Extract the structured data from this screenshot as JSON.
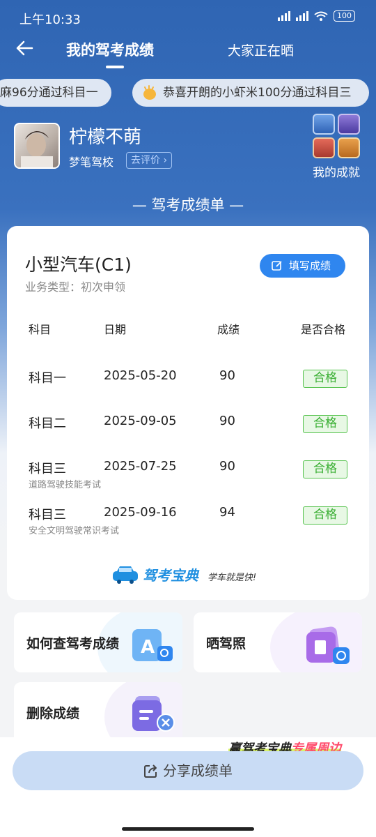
{
  "status_bar": {
    "time": "上午10:33",
    "battery": "100"
  },
  "header": {
    "title": "我的驾考成绩",
    "tab_other": "大家正在晒"
  },
  "ticker": [
    {
      "text": "麻96分通过科目一"
    },
    {
      "text": "恭喜开朗的小虾米100分通过科目三"
    }
  ],
  "profile": {
    "name": "柠檬不萌",
    "school": "梦笔驾校",
    "rate_label": "去评价",
    "achievements_label": "我的成就"
  },
  "section_title": "— 驾考成绩单 —",
  "card": {
    "license": "小型汽车(C1)",
    "business_type": "业务类型：初次申领",
    "fill_button": "填写成绩",
    "columns": [
      "科目",
      "日期",
      "成绩",
      "是否合格"
    ],
    "rows": [
      {
        "subject": "科目一",
        "date": "2025-05-20",
        "score": "90",
        "status": "合格",
        "note": ""
      },
      {
        "subject": "科目二",
        "date": "2025-09-05",
        "score": "90",
        "status": "合格",
        "note": ""
      },
      {
        "subject": "科目三",
        "date": "2025-07-25",
        "score": "90",
        "status": "合格",
        "note": "道路驾驶技能考试"
      },
      {
        "subject": "科目三",
        "date": "2025-09-16",
        "score": "94",
        "status": "合格",
        "note": "安全文明驾驶常识考试"
      }
    ],
    "brand": "驾考宝典",
    "slogan": "学车就是快!"
  },
  "actions": [
    {
      "label": "如何查驾考成绩",
      "icon": "query-icon"
    },
    {
      "label": "晒驾照",
      "icon": "photo-icon"
    },
    {
      "label": "删除成绩",
      "icon": "delete-icon"
    }
  ],
  "promo": {
    "part1": "赢驾考宝典",
    "part2": "专属周边"
  },
  "share_button": "分享成绩单",
  "colors": {
    "primary": "#2f86ef",
    "header_bg": "#2f65b3",
    "pass_green": "#3aaf33"
  }
}
